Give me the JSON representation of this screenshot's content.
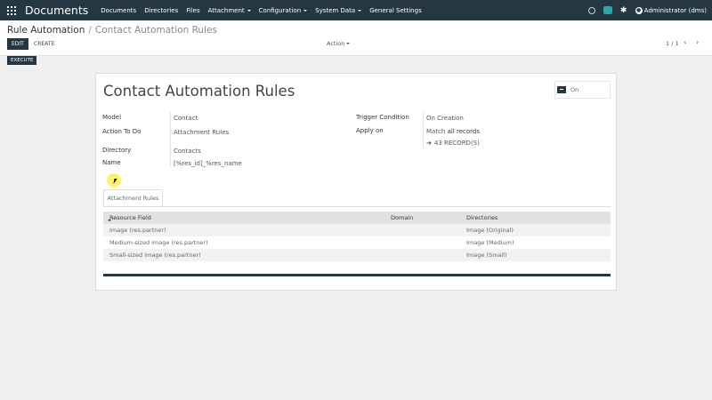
{
  "navbar": {
    "brand": "Documents",
    "menu": [
      {
        "label": "Documents",
        "dropdown": false
      },
      {
        "label": "Directories",
        "dropdown": false
      },
      {
        "label": "Files",
        "dropdown": false
      },
      {
        "label": "Attachment",
        "dropdown": true
      },
      {
        "label": "Configuration",
        "dropdown": true
      },
      {
        "label": "System Data",
        "dropdown": true
      },
      {
        "label": "General Settings",
        "dropdown": false
      }
    ],
    "user": "Administrator (dms)",
    "icons": [
      "activity-clock-icon",
      "chat-icon",
      "debug-bug-icon"
    ]
  },
  "control_panel": {
    "breadcrumb_parent": "Rule Automation",
    "breadcrumb_separator": "/",
    "breadcrumb_current": "Contact Automation Rules",
    "edit_label": "EDIT",
    "create_label": "CREATE",
    "action_label": "Action",
    "pager": "1 / 1",
    "prev_icon": "‹",
    "next_icon": "›"
  },
  "statusbar": {
    "execute_label": "EXECUTE"
  },
  "form": {
    "title": "Contact Automation Rules",
    "active_toggle": "On",
    "fields_left": [
      {
        "label": "Model",
        "value": "Contact"
      },
      {
        "label": "Action To Do",
        "value": "Attachment Rules"
      },
      {
        "label": "Directory",
        "value": "Contacts"
      },
      {
        "label": "Name",
        "value": "[%res_id]_%res_name"
      }
    ],
    "fields_right": {
      "trigger_label": "Trigger Condition",
      "trigger_value": "On Creation",
      "apply_label": "Apply on",
      "apply_prefix": "Match",
      "apply_value": "all records",
      "records_link": "43 RECORD(S)"
    },
    "tab_label": "Attachment Rules",
    "table": {
      "columns": [
        "Resource Field",
        "Domain",
        "Directories"
      ],
      "rows": [
        {
          "resource_field": "Image (res.partner)",
          "domain": "",
          "directory": "Image (Original)"
        },
        {
          "resource_field": "Medium-sized image (res.partner)",
          "domain": "",
          "directory": "Image (Medium)"
        },
        {
          "resource_field": "Small-sized image (res.partner)",
          "domain": "",
          "directory": "Image (Small)"
        }
      ]
    }
  },
  "colors": {
    "navbar": "#243742",
    "button": "#243742",
    "background": "#f0f0f0"
  }
}
